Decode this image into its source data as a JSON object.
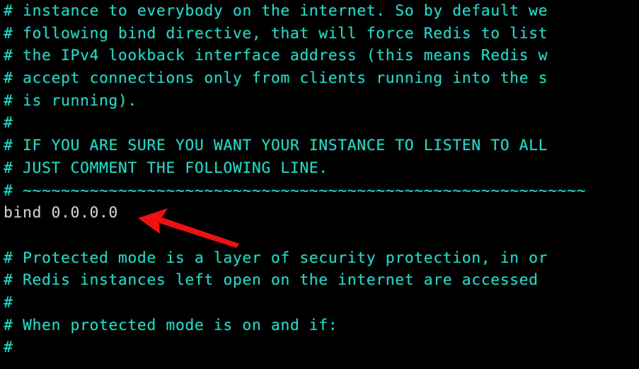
{
  "terminal": {
    "background_color": "#000000",
    "comment_color": "#26d6c4",
    "text_color": "#d2d2d2",
    "annotation_color": "#ee1111",
    "font_size_px": 21.5,
    "line_height_px": 31.7,
    "lines": [
      {
        "id": "line-1",
        "type": "comment",
        "text": "# instance to everybody on the internet. So by default we"
      },
      {
        "id": "line-2",
        "type": "comment",
        "text": "# following bind directive, that will force Redis to list"
      },
      {
        "id": "line-3",
        "type": "comment",
        "text": "# the IPv4 lookback interface address (this means Redis w"
      },
      {
        "id": "line-4",
        "type": "comment",
        "text": "# accept connections only from clients running into the s"
      },
      {
        "id": "line-5",
        "type": "comment",
        "text": "# is running)."
      },
      {
        "id": "line-6",
        "type": "comment",
        "text": "#"
      },
      {
        "id": "line-7",
        "type": "comment",
        "text": "# IF YOU ARE SURE YOU WANT YOUR INSTANCE TO LISTEN TO ALL"
      },
      {
        "id": "line-8",
        "type": "comment",
        "text": "# JUST COMMENT THE FOLLOWING LINE."
      },
      {
        "id": "line-9",
        "type": "comment",
        "text": "# ~~~~~~~~~~~~~~~~~~~~~~~~~~~~~~~~~~~~~~~~~~~~~~~~~~~~~~~~~~~"
      },
      {
        "id": "line-10",
        "type": "directive",
        "text": "bind 0.0.0.0"
      },
      {
        "id": "line-11",
        "type": "blank",
        "text": " "
      },
      {
        "id": "line-12",
        "type": "comment",
        "text": "# Protected mode is a layer of security protection, in or"
      },
      {
        "id": "line-13",
        "type": "comment",
        "text": "# Redis instances left open on the internet are accessed"
      },
      {
        "id": "line-14",
        "type": "comment",
        "text": "#"
      },
      {
        "id": "line-15",
        "type": "comment",
        "text": "# When protected mode is on and if:"
      },
      {
        "id": "line-16",
        "type": "comment",
        "text": "#"
      }
    ]
  },
  "annotation": {
    "arrow_label": "red-arrow-pointing-to-bind-directive",
    "color": "#ee1111",
    "points_to": "bind 0.0.0.0"
  }
}
